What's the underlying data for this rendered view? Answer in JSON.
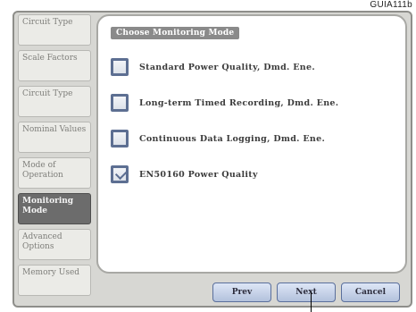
{
  "figure_id": "GUIA111b",
  "sidebar": {
    "items": [
      {
        "label": "Circuit Type"
      },
      {
        "label": "Scale Factors"
      },
      {
        "label": "Circuit Type"
      },
      {
        "label": "Nominal Values"
      },
      {
        "label": "Mode of Operation"
      },
      {
        "label": "Monitoring Mode",
        "active": true
      },
      {
        "label": "Advanced Options"
      },
      {
        "label": "Memory Used"
      }
    ]
  },
  "main": {
    "title": "Choose Monitoring Mode",
    "options": [
      {
        "label": "Standard Power Quality, Dmd. Ene.",
        "checked": false
      },
      {
        "label": "Long-term Timed Recording, Dmd. Ene.",
        "checked": false
      },
      {
        "label": "Continuous Data Logging, Dmd. Ene.",
        "checked": false
      },
      {
        "label": "EN50160 Power Quality",
        "checked": true
      }
    ]
  },
  "buttons": {
    "prev": "Prev",
    "next": "Next",
    "cancel": "Cancel"
  },
  "colors": {
    "frame": "#d7d7d3",
    "active_tab": "#6c6c6c",
    "checkbox_border": "#5d6f92",
    "button_gradient_top": "#dde6f6",
    "button_gradient_bottom": "#b3c1dc"
  }
}
